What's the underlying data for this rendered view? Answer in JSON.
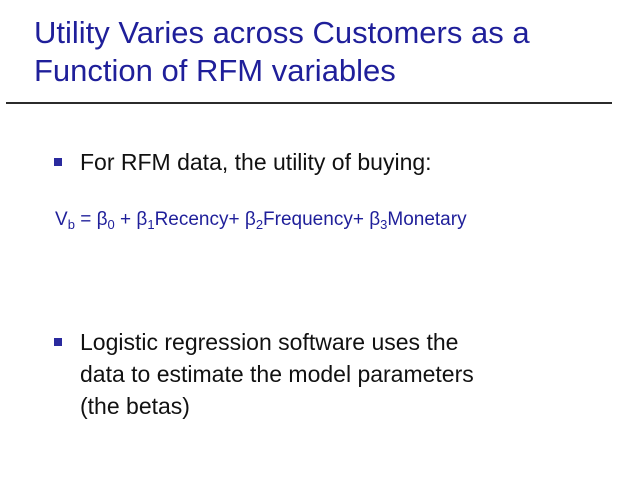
{
  "slide": {
    "title_lines": [
      "Utility Varies across Customers as a",
      "Function of RFM variables"
    ],
    "bullets": [
      {
        "lines": [
          "For RFM data, the utility of buying:"
        ]
      },
      {
        "lines": [
          "Logistic regression software uses the",
          "data to estimate the model parameters",
          "(the betas)"
        ]
      }
    ],
    "equation": {
      "lhs_symbol": "V",
      "lhs_sub": "b",
      "equals": " = ",
      "b0_symbol": "β",
      "b0_sub": "0",
      "plus1": " + ",
      "b1_symbol": "β",
      "b1_sub": "1",
      "term1": "Recency+ ",
      "b2_symbol": "β",
      "b2_sub": "2",
      "term2": "Frequency+ ",
      "b3_symbol": "β",
      "b3_sub": "3",
      "term3": "Monetary"
    },
    "colors": {
      "title": "#1f1f9a",
      "equation": "#1f1f9a",
      "bullet_marker": "#2a2a9e",
      "rule": "#2b2b2b",
      "body_text": "#111111"
    }
  }
}
